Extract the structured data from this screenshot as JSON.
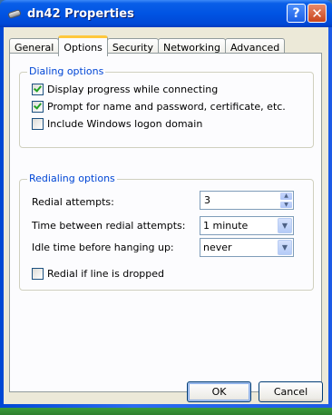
{
  "window": {
    "title": "dn42 Properties",
    "help_label": "?",
    "close_label": "✕"
  },
  "tabs": [
    {
      "label": "General",
      "active": false
    },
    {
      "label": "Options",
      "active": true
    },
    {
      "label": "Security",
      "active": false
    },
    {
      "label": "Networking",
      "active": false
    },
    {
      "label": "Advanced",
      "active": false
    }
  ],
  "dialing": {
    "legend": "Dialing options",
    "items": [
      {
        "label": "Display progress while connecting",
        "checked": true
      },
      {
        "label": "Prompt for name and password, certificate, etc.",
        "checked": true
      },
      {
        "label": "Include Windows logon domain",
        "checked": false
      }
    ]
  },
  "redialing": {
    "legend": "Redialing options",
    "attempts_label": "Redial attempts:",
    "attempts_value": "3",
    "time_label": "Time between redial attempts:",
    "time_value": "1 minute",
    "idle_label": "Idle time before hanging up:",
    "idle_value": "never",
    "redial_dropped_label": "Redial if line is dropped",
    "redial_dropped_checked": false
  },
  "buttons": {
    "ok": "OK",
    "cancel": "Cancel"
  },
  "icons": {
    "title": "dialup-connection-icon",
    "help": "help-icon",
    "close": "close-icon",
    "spin_up": "spin-up-icon",
    "spin_down": "spin-down-icon",
    "dropdown": "dropdown-arrow-icon"
  },
  "colors": {
    "titlebar": "#0054e3",
    "group_legend": "#0046d5",
    "active_tab_accent": "#ffc83c",
    "dialog_bg": "#ece9d8"
  }
}
